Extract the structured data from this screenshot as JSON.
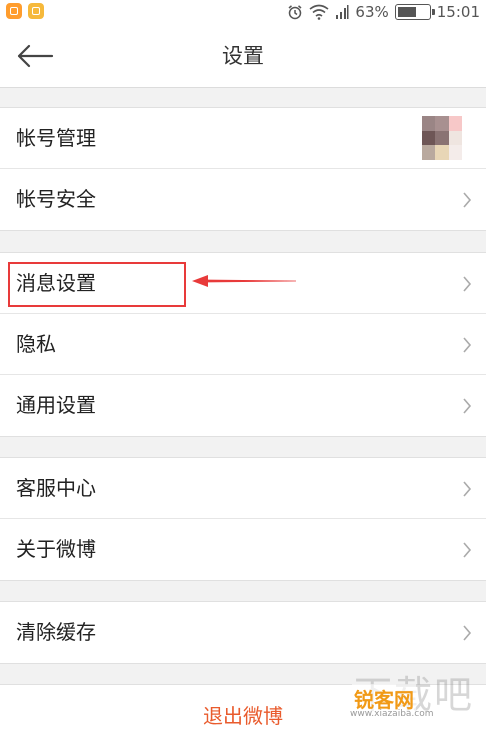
{
  "status_bar": {
    "battery": "63%",
    "battery_level": 0.63,
    "time": "15:01",
    "icons": [
      "app-notification-icon",
      "app-notification-icon",
      "alarm-icon",
      "wifi-icon",
      "signal-icon",
      "battery-icon"
    ]
  },
  "header": {
    "title": "设置",
    "back_icon": "back-arrow-icon"
  },
  "groups": [
    {
      "items": [
        {
          "label": "帐号管理",
          "trailing": "avatar"
        },
        {
          "label": "帐号安全",
          "trailing": "chevron-right-icon"
        }
      ]
    },
    {
      "items": [
        {
          "label": "消息设置",
          "trailing": "chevron-right-icon",
          "highlighted": true
        },
        {
          "label": "隐私",
          "trailing": "chevron-right-icon"
        },
        {
          "label": "通用设置",
          "trailing": "chevron-right-icon"
        }
      ]
    },
    {
      "items": [
        {
          "label": "客服中心",
          "trailing": "chevron-right-icon"
        },
        {
          "label": "关于微博",
          "trailing": "chevron-right-icon"
        }
      ]
    },
    {
      "items": [
        {
          "label": "清除缓存",
          "trailing": "chevron-right-icon"
        }
      ]
    }
  ],
  "logout": {
    "label": "退出微博",
    "color": "#e95b2d"
  },
  "annotation": {
    "highlight_color": "#e83a3a"
  },
  "watermark": {
    "text_large": "下载吧",
    "brand": "锐客网",
    "url": "www.xiazaiba.com"
  }
}
